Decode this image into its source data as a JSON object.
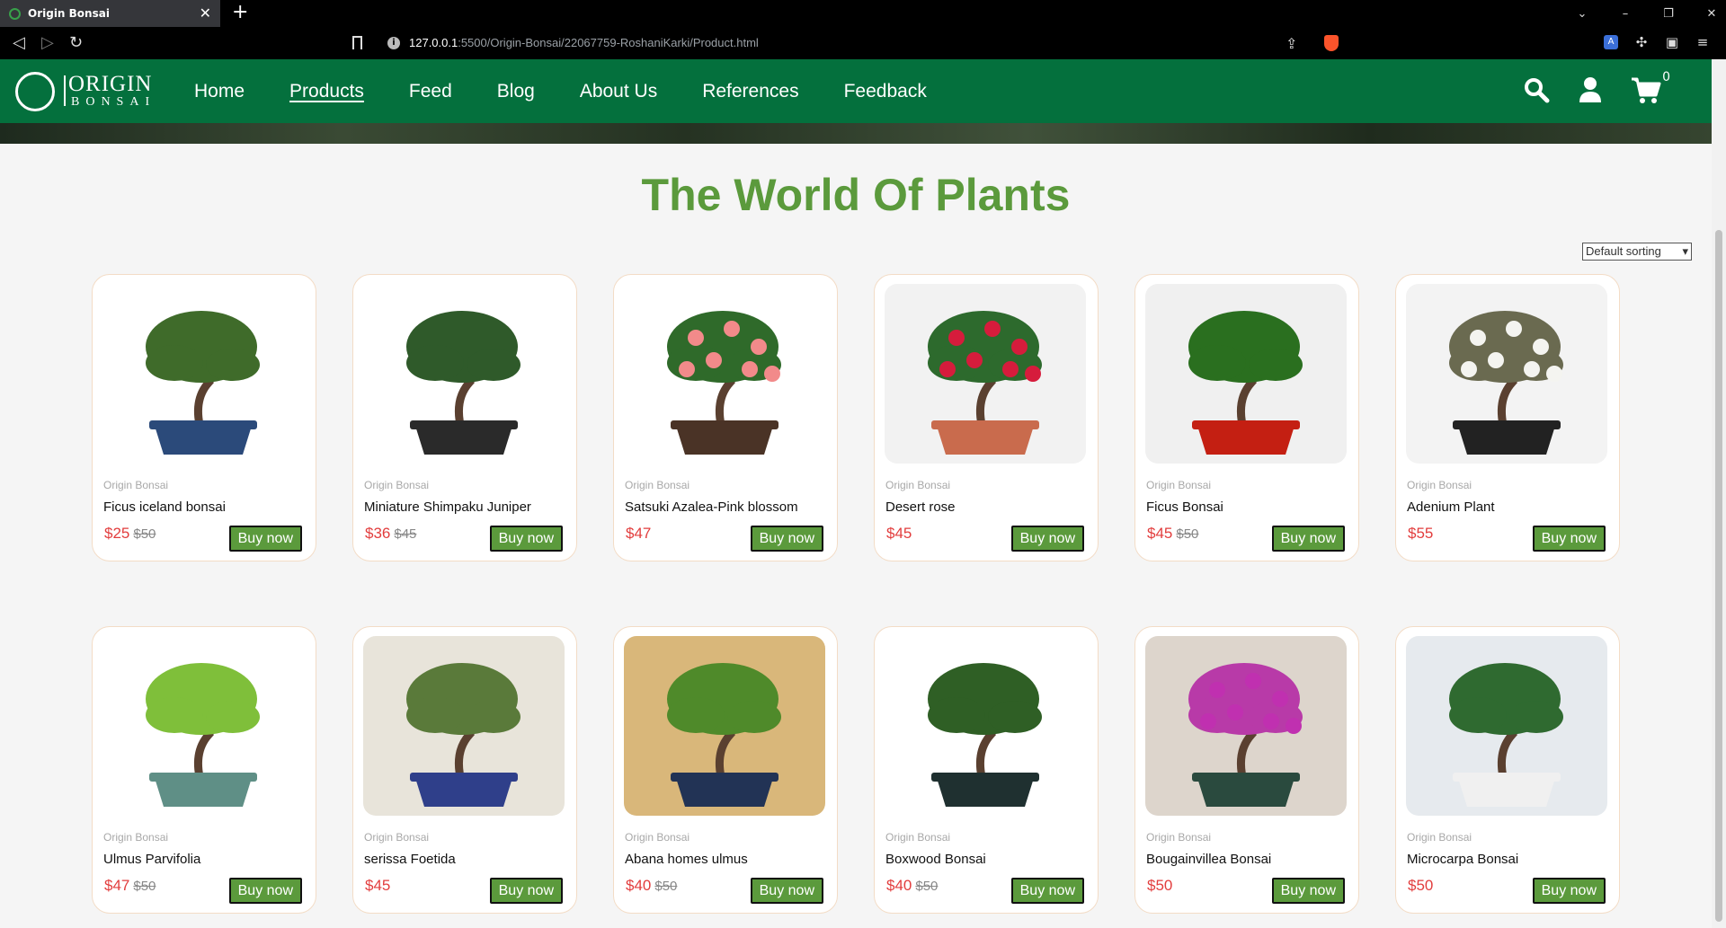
{
  "browser": {
    "tab_title": "Origin Bonsai",
    "url_host": "127.0.0.1",
    "url_rest": ":5500/Origin-Bonsai/22067759-RoshaniKarki/Product.html"
  },
  "site": {
    "logo_top": "ORIGIN",
    "logo_bottom": "BONSAI",
    "nav": [
      {
        "label": "Home"
      },
      {
        "label": "Products",
        "active": true
      },
      {
        "label": "Feed"
      },
      {
        "label": "Blog"
      },
      {
        "label": "About Us"
      },
      {
        "label": "References"
      },
      {
        "label": "Feedback"
      }
    ],
    "cart_count": "0"
  },
  "page": {
    "title": "The World Of Plants",
    "sort_selected": "Default sorting",
    "buy_label": "Buy now",
    "products": [
      {
        "brand": "Origin Bonsai",
        "name": "Ficus iceland bonsai",
        "price": "$25",
        "old_price": "$50"
      },
      {
        "brand": "Origin Bonsai",
        "name": "Miniature Shimpaku Juniper",
        "price": "$36",
        "old_price": "$45"
      },
      {
        "brand": "Origin Bonsai",
        "name": "Satsuki Azalea-Pink blossom",
        "price": "$47",
        "old_price": ""
      },
      {
        "brand": "Origin Bonsai",
        "name": "Desert rose",
        "price": "$45",
        "old_price": ""
      },
      {
        "brand": "Origin Bonsai",
        "name": "Ficus Bonsai",
        "price": "$45",
        "old_price": "$50"
      },
      {
        "brand": "Origin Bonsai",
        "name": "Adenium Plant",
        "price": "$55",
        "old_price": ""
      },
      {
        "brand": "Origin Bonsai",
        "name": "Ulmus Parvifolia",
        "price": "$47",
        "old_price": "$50"
      },
      {
        "brand": "Origin Bonsai",
        "name": "serissa Foetida",
        "price": "$45",
        "old_price": ""
      },
      {
        "brand": "Origin Bonsai",
        "name": "Abana homes ulmus",
        "price": "$40",
        "old_price": "$50"
      },
      {
        "brand": "Origin Bonsai",
        "name": "Boxwood Bonsai",
        "price": "$40",
        "old_price": "$50"
      },
      {
        "brand": "Origin Bonsai",
        "name": "Bougainvillea Bonsai",
        "price": "$50",
        "old_price": ""
      },
      {
        "brand": "Origin Bonsai",
        "name": "Microcarpa Bonsai",
        "price": "$50",
        "old_price": ""
      }
    ]
  },
  "colors": {
    "header_green": "#04703d",
    "title_green": "#5b9a3c",
    "price_red": "#e23d3d"
  }
}
